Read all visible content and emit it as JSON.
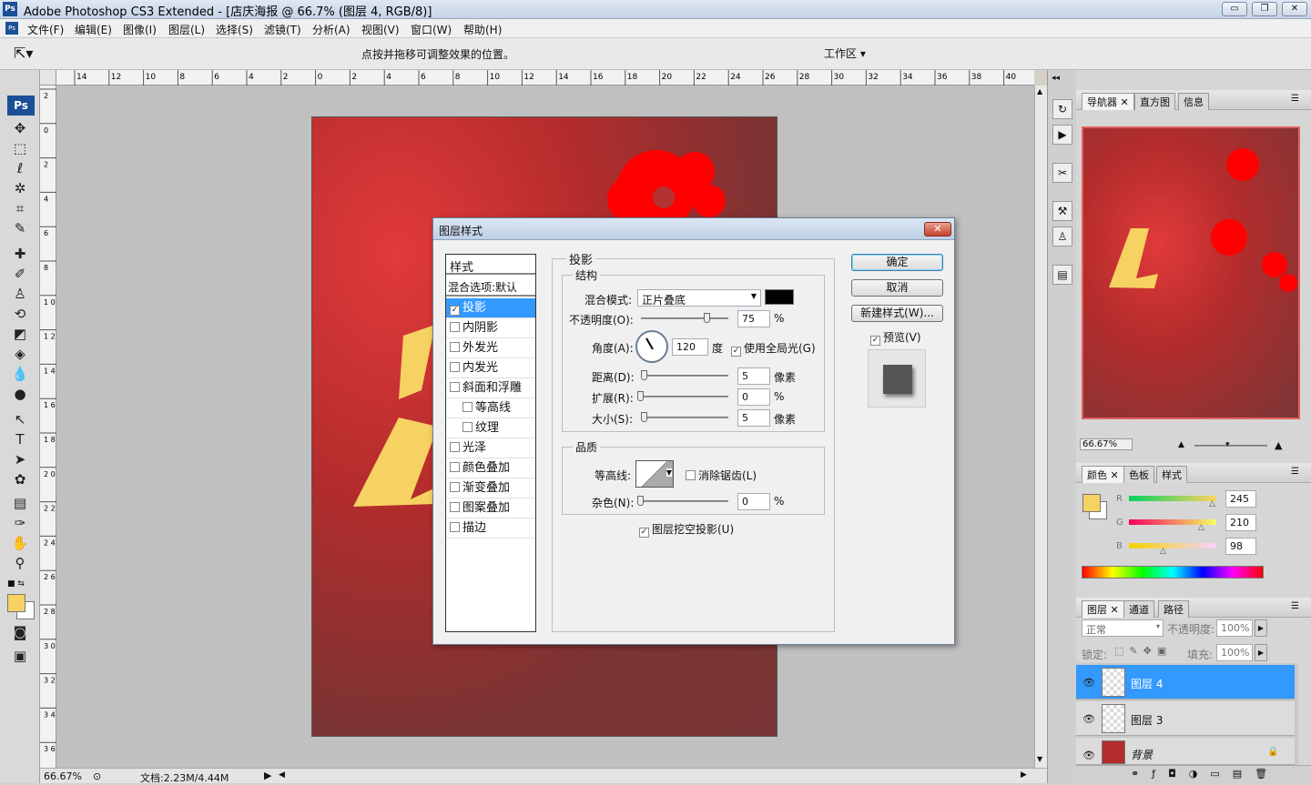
{
  "window": {
    "title": "Adobe Photoshop CS3 Extended - [店庆海报 @ 66.7% (图层 4, RGB/8)]",
    "min": "▭",
    "restore": "❐",
    "close": "✕"
  },
  "menu": [
    "文件(F)",
    "编辑(E)",
    "图像(I)",
    "图层(L)",
    "选择(S)",
    "滤镜(T)",
    "分析(A)",
    "视图(V)",
    "窗口(W)",
    "帮助(H)"
  ],
  "options": {
    "hint": "点按并拖移可调整效果的位置。",
    "workspace": "工作区 ▾"
  },
  "ruler_top": [
    "14",
    "12",
    "10",
    "8",
    "6",
    "4",
    "2",
    "0",
    "2",
    "4",
    "6",
    "8",
    "10",
    "12",
    "14",
    "16",
    "18",
    "20",
    "22",
    "24",
    "26",
    "28",
    "30",
    "32",
    "34",
    "36",
    "38",
    "40"
  ],
  "ruler_left": [
    "2",
    "0",
    "2",
    "4",
    "6",
    "8",
    "1\n0",
    "1\n2",
    "1\n4",
    "1\n6",
    "1\n8",
    "2\n0",
    "2\n2",
    "2\n4",
    "2\n6",
    "2\n8",
    "3\n0",
    "3\n2",
    "3\n4",
    "3\n6"
  ],
  "status": {
    "zoom": "66.67%",
    "doc": "文档:2.23M/4.44M"
  },
  "dialog": {
    "title": "图层样式",
    "close": "✕",
    "styles_header": "样式",
    "blend_default": "混合选项:默认",
    "styles": [
      {
        "label": "投影",
        "checked": true,
        "selected": true,
        "indent": false
      },
      {
        "label": "内阴影",
        "checked": false,
        "selected": false,
        "indent": false
      },
      {
        "label": "外发光",
        "checked": false,
        "selected": false,
        "indent": false
      },
      {
        "label": "内发光",
        "checked": false,
        "selected": false,
        "indent": false
      },
      {
        "label": "斜面和浮雕",
        "checked": false,
        "selected": false,
        "indent": false
      },
      {
        "label": "等高线",
        "checked": false,
        "selected": false,
        "indent": true
      },
      {
        "label": "纹理",
        "checked": false,
        "selected": false,
        "indent": true
      },
      {
        "label": "光泽",
        "checked": false,
        "selected": false,
        "indent": false
      },
      {
        "label": "颜色叠加",
        "checked": false,
        "selected": false,
        "indent": false
      },
      {
        "label": "渐变叠加",
        "checked": false,
        "selected": false,
        "indent": false
      },
      {
        "label": "图案叠加",
        "checked": false,
        "selected": false,
        "indent": false
      },
      {
        "label": "描边",
        "checked": false,
        "selected": false,
        "indent": false
      }
    ],
    "section": "投影",
    "structure": "结构",
    "blend_mode_label": "混合模式:",
    "blend_mode": "正片叠底",
    "opacity_label": "不透明度(O):",
    "opacity": "75",
    "opacity_unit": "%",
    "angle_label": "角度(A):",
    "angle": "120",
    "angle_unit": "度",
    "global_light": "使用全局光(G)",
    "distance_label": "距离(D):",
    "distance": "5",
    "distance_unit": "像素",
    "spread_label": "扩展(R):",
    "spread": "0",
    "spread_unit": "%",
    "size_label": "大小(S):",
    "size": "5",
    "size_unit": "像素",
    "quality": "品质",
    "contour_label": "等高线:",
    "antialias": "消除锯齿(L)",
    "noise_label": "杂色(N):",
    "noise": "0",
    "noise_unit": "%",
    "knockout": "图层挖空投影(U)",
    "ok": "确定",
    "cancel": "取消",
    "new_style": "新建样式(W)...",
    "preview": "预览(V)"
  },
  "navigator": {
    "tabs": [
      "导航器",
      "直方图",
      "信息"
    ],
    "zoom": "66.67%"
  },
  "color": {
    "tabs": [
      "颜色",
      "色板",
      "样式"
    ],
    "r_label": "R",
    "g_label": "G",
    "b_label": "B",
    "r": "245",
    "g": "210",
    "b": "98",
    "fg": "#f5d262"
  },
  "layers": {
    "tabs": [
      "图层",
      "通道",
      "路径"
    ],
    "mode": "正常",
    "opacity_label": "不透明度:",
    "opacity": "100%",
    "lock_label": "锁定:",
    "fill_label": "填充:",
    "fill": "100%",
    "items": [
      {
        "name": "图层 4",
        "selected": true
      },
      {
        "name": "图层 3",
        "selected": false
      },
      {
        "name": "背景",
        "selected": false
      }
    ]
  },
  "colors": {
    "accent": "#3399ff",
    "doc_red": "#b52c2c",
    "yellow": "#f5d262",
    "bright_red": "#ff0000"
  }
}
